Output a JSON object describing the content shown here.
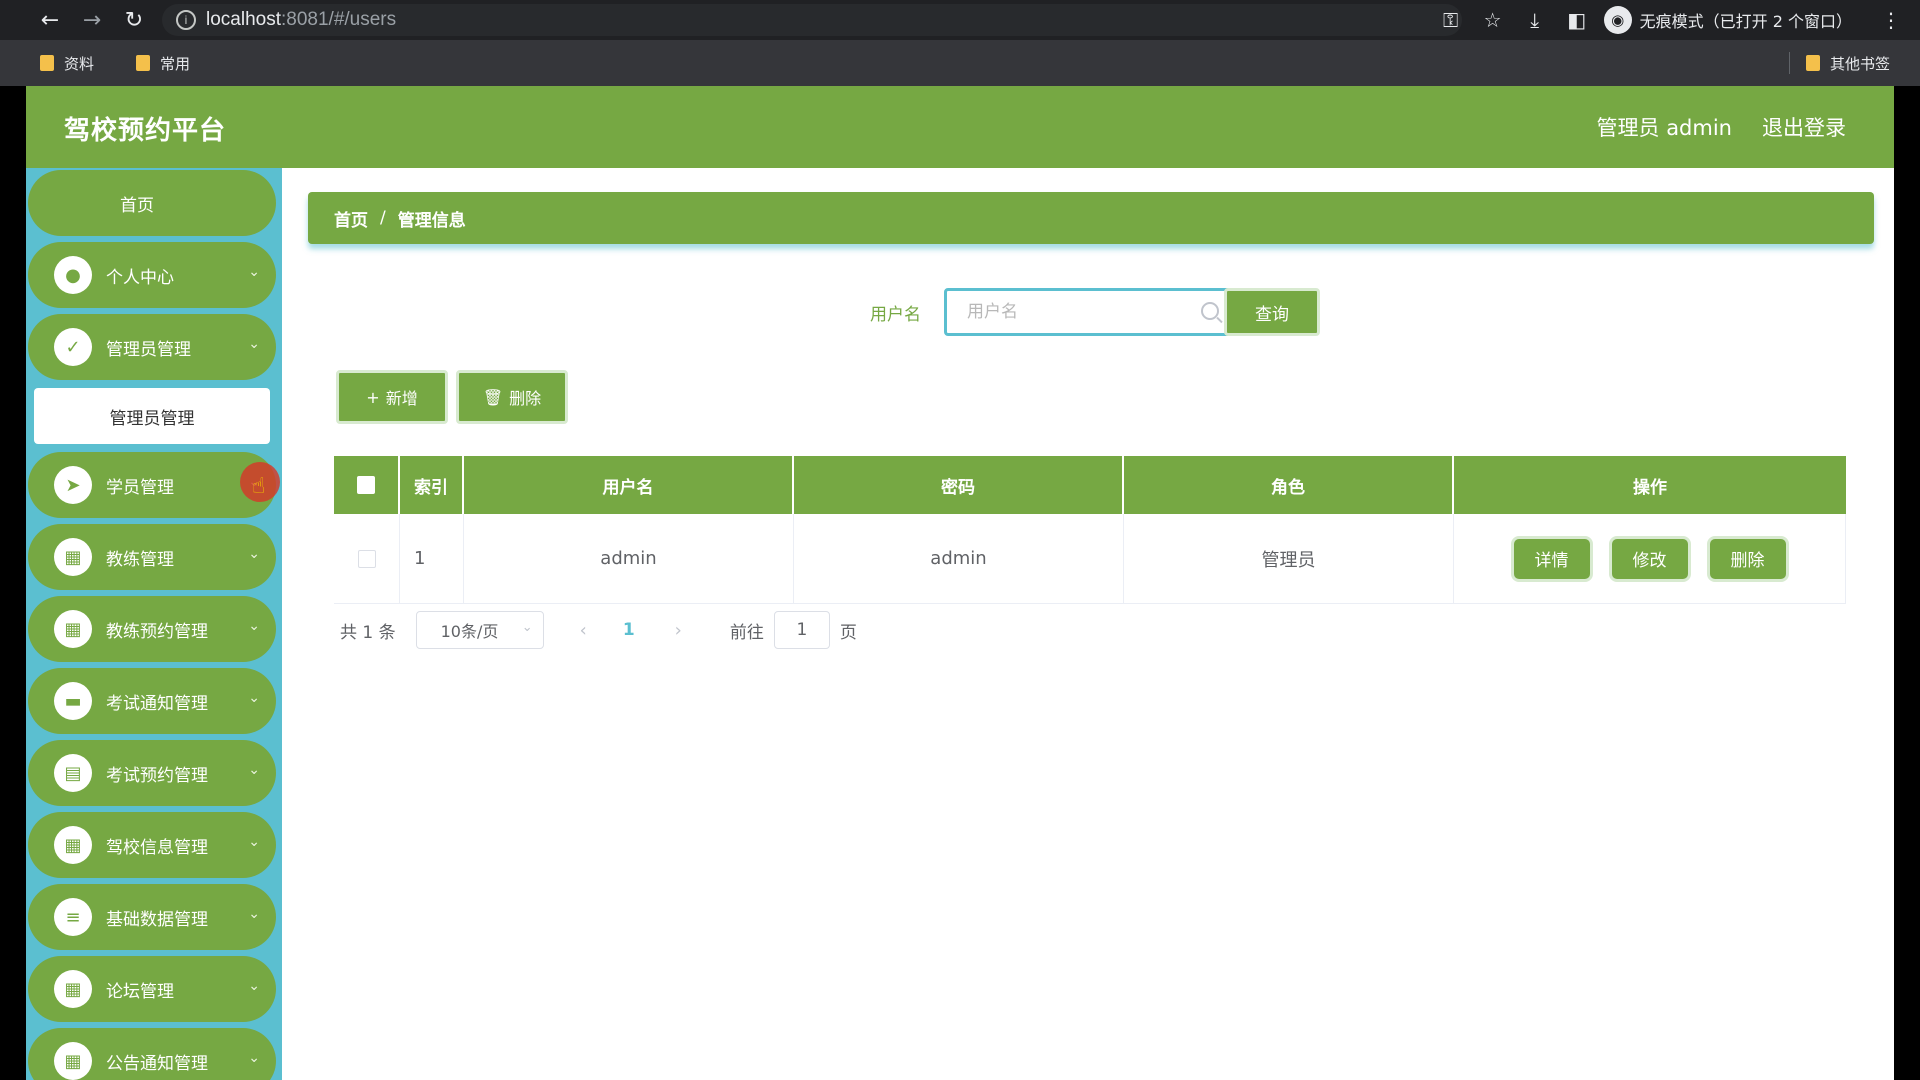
{
  "browser": {
    "url_host": "localhost",
    "url_path": ":8081/#/users",
    "incognito_label": "无痕模式（已打开 2 个窗口）",
    "bookmarks": [
      "资料",
      "常用"
    ],
    "other_bookmarks": "其他书签"
  },
  "header": {
    "brand": "驾校预约平台",
    "user_label": "管理员 admin",
    "logout": "退出登录"
  },
  "sidebar": {
    "home": "首页",
    "items": [
      {
        "label": "个人中心",
        "icon": "user-icon"
      },
      {
        "label": "管理员管理",
        "icon": "clipboard-check-icon"
      },
      {
        "label": "学员管理",
        "icon": "send-icon"
      },
      {
        "label": "教练管理",
        "icon": "grid-icon"
      },
      {
        "label": "教练预约管理",
        "icon": "grid-icon"
      },
      {
        "label": "考试通知管理",
        "icon": "briefcase-icon"
      },
      {
        "label": "考试预约管理",
        "icon": "clipboard-icon"
      },
      {
        "label": "驾校信息管理",
        "icon": "grid-icon"
      },
      {
        "label": "基础数据管理",
        "icon": "sliders-icon"
      },
      {
        "label": "论坛管理",
        "icon": "grid-icon"
      },
      {
        "label": "公告通知管理",
        "icon": "grid-icon"
      }
    ],
    "sub_item": "管理员管理"
  },
  "breadcrumb": {
    "home": "首页",
    "separator": "/",
    "current": "管理信息"
  },
  "search": {
    "label": "用户名",
    "placeholder": "用户名",
    "button": "查询"
  },
  "toolbar": {
    "add": "新增",
    "delete": "删除"
  },
  "table": {
    "columns": [
      "索引",
      "用户名",
      "密码",
      "角色",
      "操作"
    ],
    "rows": [
      {
        "index": "1",
        "username": "admin",
        "password": "admin",
        "role": "管理员"
      }
    ],
    "actions": [
      "详情",
      "修改",
      "删除"
    ]
  },
  "pagination": {
    "total": "共 1 条",
    "page_size": "10条/页",
    "current_page": "1",
    "goto_label": "前往",
    "goto_value": "1",
    "goto_suffix": "页"
  },
  "colors": {
    "primary_green": "#76a843",
    "sidebar_cyan": "#5bbfd0"
  }
}
